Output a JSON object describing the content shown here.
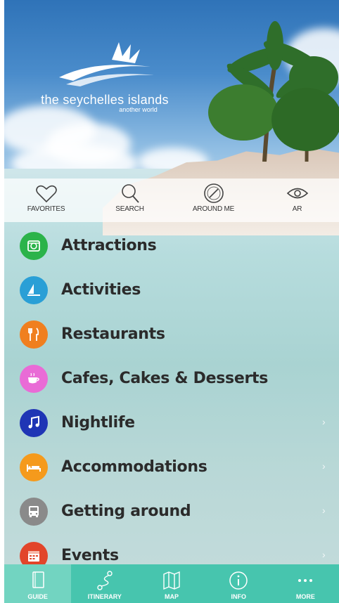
{
  "brand": {
    "title": "the seychelles islands",
    "subtitle": "another world"
  },
  "quick_actions": [
    {
      "label": "FAVORITES",
      "icon": "heart-icon"
    },
    {
      "label": "SEARCH",
      "icon": "search-icon"
    },
    {
      "label": "AROUND ME",
      "icon": "compass-icon"
    },
    {
      "label": "AR",
      "icon": "eye-icon"
    }
  ],
  "categories": [
    {
      "label": "Attractions",
      "icon": "attractions-icon",
      "color": "#2bb34a"
    },
    {
      "label": "Activities",
      "icon": "windsurf-icon",
      "color": "#2a9fd6"
    },
    {
      "label": "Restaurants",
      "icon": "fork-knife-icon",
      "color": "#f07f1f"
    },
    {
      "label": "Cafes, Cakes & Desserts",
      "icon": "cup-icon",
      "color": "#e96bd6"
    },
    {
      "label": "Nightlife",
      "icon": "music-note-icon",
      "color": "#1f35b5"
    },
    {
      "label": "Accommodations",
      "icon": "bed-icon",
      "color": "#f59a1c"
    },
    {
      "label": "Getting around",
      "icon": "bus-icon",
      "color": "#8a8a8a"
    },
    {
      "label": "Events",
      "icon": "calendar-icon",
      "color": "#e2452a"
    }
  ],
  "tabs": [
    {
      "label": "GUIDE",
      "icon": "book-icon",
      "active": true
    },
    {
      "label": "ITINERARY",
      "icon": "route-icon",
      "active": false
    },
    {
      "label": "MAP",
      "icon": "map-icon",
      "active": false
    },
    {
      "label": "INFO",
      "icon": "info-icon",
      "active": false
    },
    {
      "label": "MORE",
      "icon": "more-icon",
      "active": false
    }
  ],
  "colors": {
    "tabbar": "#47c5ae",
    "tab_active": "#72d4c1"
  }
}
